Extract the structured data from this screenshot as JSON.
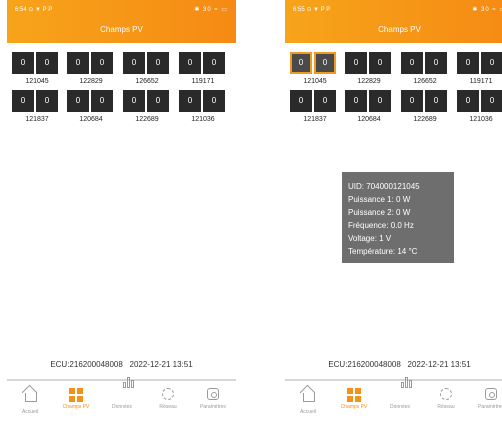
{
  "screens": [
    {
      "status_time": "6:54",
      "status_icons": "⊙ ▼ P P",
      "status_right": "✱ 30 ≈ ▭",
      "title": "Champs PV",
      "rows": [
        {
          "cells": [
            "0",
            "0",
            "0",
            "0",
            "0",
            "0",
            "0",
            "0"
          ],
          "labels": [
            "121045",
            "122829",
            "126652",
            "119171"
          ]
        },
        {
          "cells": [
            "0",
            "0",
            "0",
            "0",
            "0",
            "0",
            "0",
            "0"
          ],
          "labels": [
            "121837",
            "120684",
            "122689",
            "121036"
          ]
        }
      ],
      "ecu_text": "ECU:216200048008",
      "date_text": "2022-12-21 13:51"
    },
    {
      "status_time": "6:55",
      "status_icons": "⊙ ▼ P P",
      "status_right": "✱ 30 ≈ ▭",
      "title": "Champs PV",
      "rows": [
        {
          "cells": [
            "0",
            "0",
            "0",
            "0",
            "0",
            "0",
            "0",
            "0"
          ],
          "labels": [
            "121045",
            "122829",
            "126652",
            "119171"
          ]
        },
        {
          "cells": [
            "0",
            "0",
            "0",
            "0",
            "0",
            "0",
            "0",
            "0"
          ],
          "labels": [
            "121837",
            "120684",
            "122689",
            "121036"
          ]
        }
      ],
      "tooltip": {
        "uid": "UID: 704000121045",
        "p1": "Puissance 1: 0 W",
        "p2": "Puissance 2: 0 W",
        "freq": "Fréquence: 0.0 Hz",
        "volt": "Voltage: 1 V",
        "temp": "Température: 14 °C"
      },
      "ecu_text": "ECU:216200048008",
      "date_text": "2022-12-21 13:51"
    }
  ],
  "tabs": [
    {
      "label": "Accueil",
      "icon": "home-icon"
    },
    {
      "label": "Champs PV",
      "icon": "grid-icon"
    },
    {
      "label": "Données",
      "icon": "bar-chart-icon"
    },
    {
      "label": "Réseau",
      "icon": "fan-icon"
    },
    {
      "label": "Paramètres",
      "icon": "settings-icon"
    }
  ],
  "colors": {
    "accent": "#f39219",
    "cell": "#2a2a2a",
    "tooltip": "#6e6e6e"
  }
}
